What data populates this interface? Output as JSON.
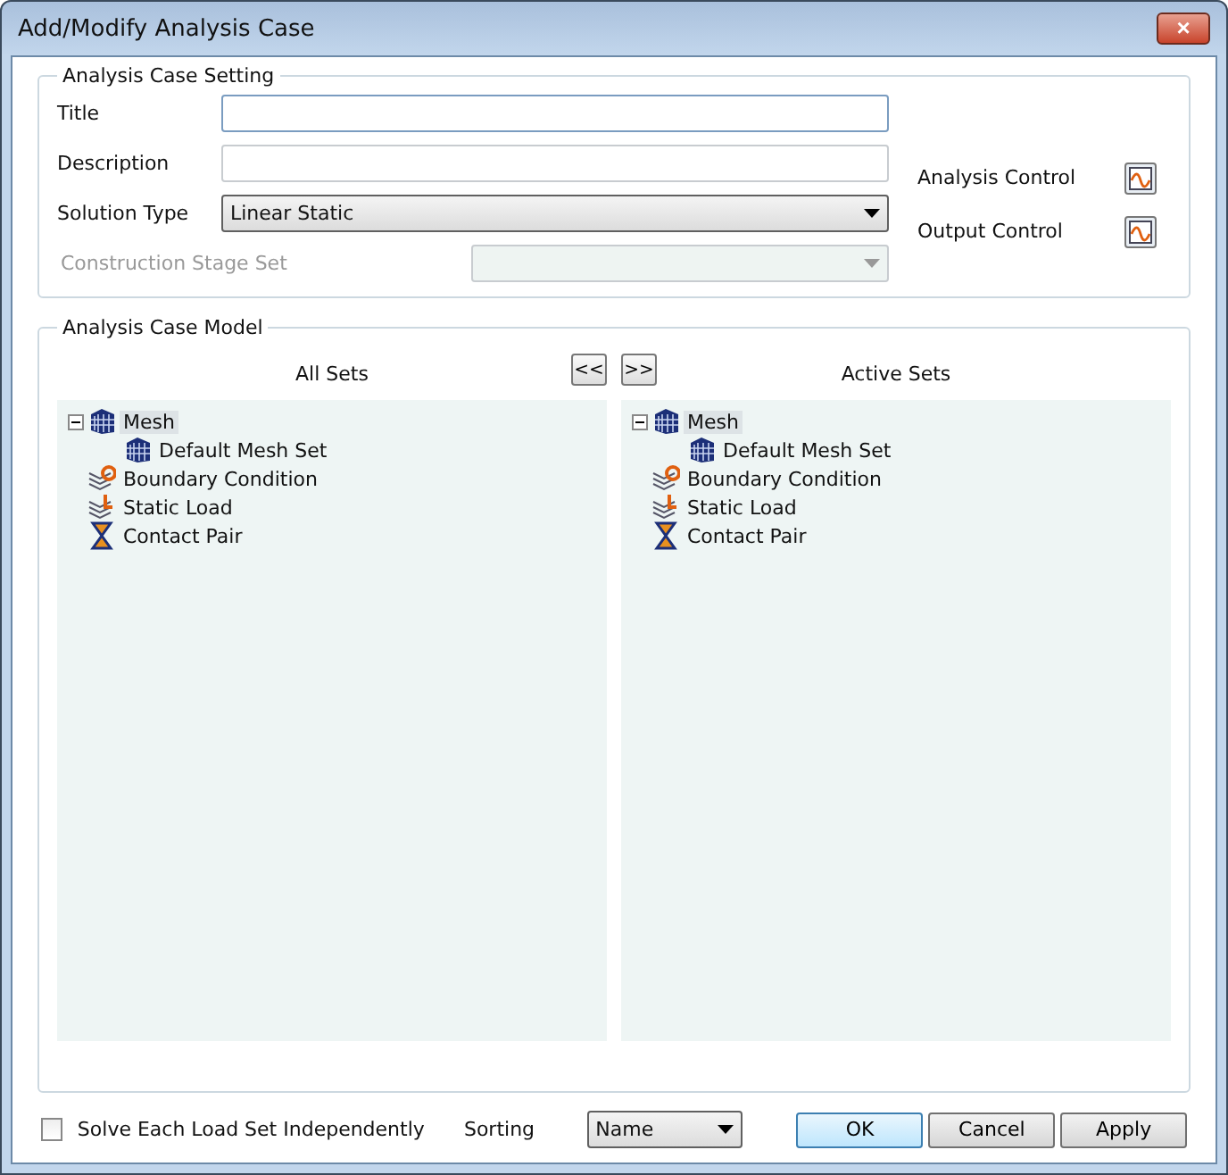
{
  "window": {
    "title": "Add/Modify Analysis Case",
    "close": "×"
  },
  "setting": {
    "legend": "Analysis Case Setting",
    "fields": [
      {
        "kind": "text",
        "label": "Title",
        "focused": true,
        "disabled": false
      },
      {
        "kind": "text",
        "label": "Description",
        "focused": false,
        "disabled": false
      },
      {
        "kind": "select",
        "label": "Solution Type",
        "value": "Linear Static",
        "disabled": false
      },
      {
        "kind": "select",
        "label": "Construction Stage Set",
        "disabled": true
      }
    ],
    "controls": [
      {
        "label": "Analysis Control"
      },
      {
        "label": "Output Control"
      }
    ]
  },
  "model": {
    "legend": "Analysis Case Model",
    "panels": [
      {
        "title": "All Sets",
        "move_button": "<<",
        "tree": [
          {
            "kind": "mesh",
            "label": "Mesh",
            "selected": true,
            "expanded": true,
            "children": [
              {
                "kind": "mesh",
                "label": "Default Mesh Set",
                "selected": false
              }
            ]
          },
          {
            "kind": "boundary",
            "label": "Boundary Condition",
            "selected": false
          },
          {
            "kind": "load",
            "label": "Static Load",
            "selected": false
          },
          {
            "kind": "contact",
            "label": "Contact Pair",
            "selected": false
          }
        ]
      },
      {
        "title": "Active Sets",
        "move_button": ">>",
        "tree": [
          {
            "kind": "mesh",
            "label": "Mesh",
            "selected": true,
            "expanded": true,
            "children": [
              {
                "kind": "mesh",
                "label": "Default Mesh Set",
                "selected": false
              }
            ]
          },
          {
            "kind": "boundary",
            "label": "Boundary Condition",
            "selected": false
          },
          {
            "kind": "load",
            "label": "Static Load",
            "selected": false
          },
          {
            "kind": "contact",
            "label": "Contact Pair",
            "selected": false
          }
        ]
      }
    ]
  },
  "footer": {
    "checkbox": {
      "label": "Solve Each Load Set Independently",
      "checked": false
    },
    "sorting_label": "Sorting",
    "sorting": "Name",
    "buttons": [
      {
        "label": "OK",
        "default": true
      },
      {
        "label": "Cancel",
        "default": false
      },
      {
        "label": "Apply",
        "default": false
      }
    ]
  }
}
